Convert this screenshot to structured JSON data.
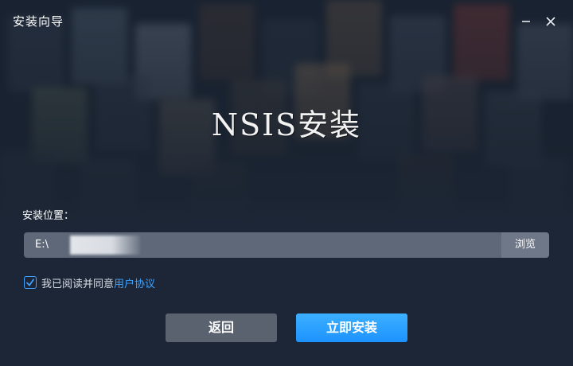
{
  "window": {
    "title": "安装向导",
    "minimize_icon": "minimize-icon",
    "close_icon": "close-icon"
  },
  "hero": {
    "title": "NSIS安装"
  },
  "install": {
    "path_label": "安装位置：",
    "path_value": "E:\\",
    "browse_label": "浏览"
  },
  "agreement": {
    "checked": true,
    "text": "我已阅读并同意",
    "link_text": "用户协议"
  },
  "buttons": {
    "back_label": "返回",
    "install_label": "立即安装"
  },
  "colors": {
    "accent": "#3ea2ff",
    "background": "#1c2636",
    "input_bg": "#5e6878",
    "back_button": "#5a6270",
    "install_button": "#1d92ff"
  }
}
